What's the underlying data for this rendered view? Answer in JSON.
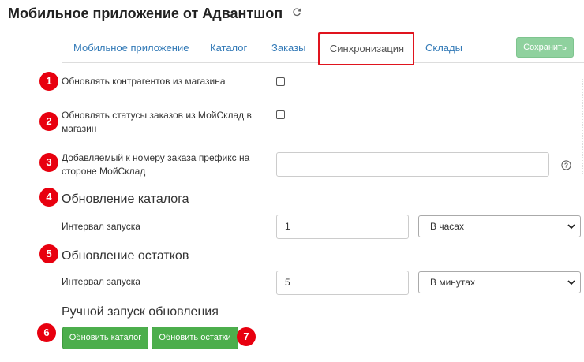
{
  "header": {
    "title": "Мобильное приложение от Адвантшоп",
    "refresh_icon": "refresh-icon"
  },
  "tabs": [
    {
      "label": "Мобильное приложение"
    },
    {
      "label": "Каталог"
    },
    {
      "label": "Заказы"
    },
    {
      "label": "Синхронизация",
      "active": true
    },
    {
      "label": "Склады"
    }
  ],
  "toolbar": {
    "save_label": "Сохранить"
  },
  "settings": {
    "update_contractors_label": "Обновлять контрагентов из магазина",
    "update_contractors_checked": false,
    "update_statuses_label": "Обновлять статусы заказов из МойСклад в магазин",
    "update_statuses_checked": false,
    "prefix_label": "Добавляемый к номеру заказа префикс на стороне МойСклад",
    "prefix_value": ""
  },
  "catalog_update": {
    "title": "Обновление каталога",
    "interval_label": "Интервал запуска",
    "interval_value": "1",
    "unit_selected": "В часах"
  },
  "stock_update": {
    "title": "Обновление остатков",
    "interval_label": "Интервал запуска",
    "interval_value": "5",
    "unit_selected": "В минутах"
  },
  "manual": {
    "title": "Ручной запуск обновления",
    "update_catalog_label": "Обновить каталог",
    "update_stock_label": "Обновить остатки"
  },
  "annotations": [
    "1",
    "2",
    "3",
    "4",
    "5",
    "6",
    "7"
  ],
  "colors": {
    "accent_link": "#337ab7",
    "highlight": "#e0141e",
    "badge": "#e8000f",
    "button_green": "#4cae4c",
    "save_disabled": "#8fd19e"
  }
}
